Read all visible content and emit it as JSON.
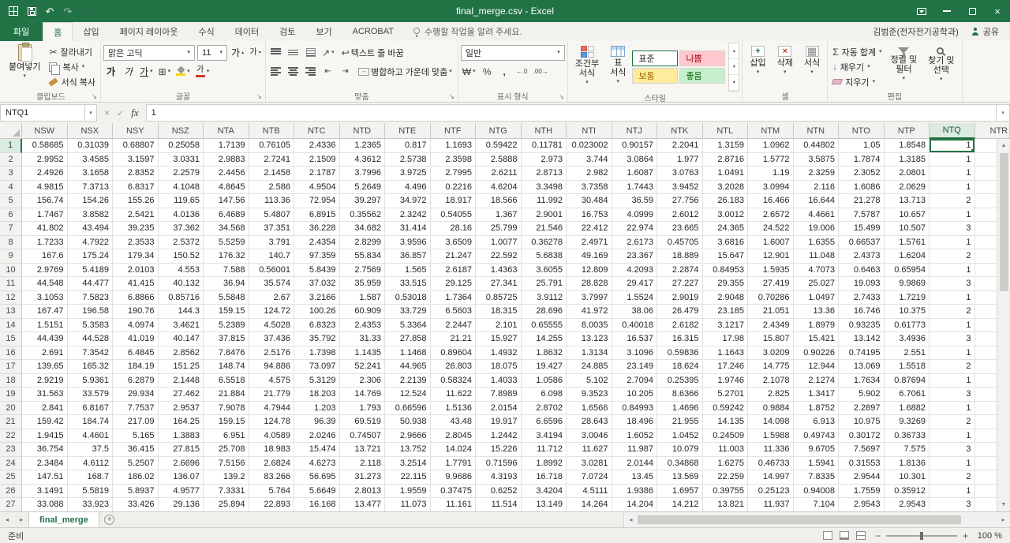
{
  "window": {
    "title": "final_merge.csv - Excel",
    "user": "김범준(전자전기공학과)",
    "share_label": "공유"
  },
  "tabs": {
    "file": "파일",
    "items": [
      "홈",
      "삽입",
      "페이지 레이아웃",
      "수식",
      "데이터",
      "검토",
      "보기",
      "ACROBAT"
    ],
    "tell_me": "수행할 작업을 알려 주세요."
  },
  "ribbon": {
    "clipboard": {
      "label": "클립보드",
      "paste": "붙여넣기",
      "cut": "잘라내기",
      "copy": "복사",
      "format_painter": "서식 복사"
    },
    "font": {
      "label": "글꼴",
      "name": "맑은 고딕",
      "size": "11"
    },
    "alignment": {
      "label": "맞춤",
      "wrap_text": "텍스트 줄 바꿈",
      "merge_center": "병합하고 가운데 맞춤"
    },
    "number": {
      "label": "표시 형식",
      "format_value": "일반"
    },
    "styles": {
      "label": "스타일",
      "conditional": "조건부\n서식",
      "format_table": "표\n서식",
      "gallery": [
        {
          "name": "표준",
          "css": "background:#ffffff;color:#262626"
        },
        {
          "name": "나쁨",
          "css": "background:#ffc7ce;color:#9c0006"
        },
        {
          "name": "보통",
          "css": "background:#ffeb9c;color:#9c6500"
        },
        {
          "name": "좋음",
          "css": "background:#c6efce;color:#006100"
        }
      ]
    },
    "cells": {
      "label": "셀",
      "insert": "삽입",
      "delete": "삭제",
      "format": "서식"
    },
    "editing": {
      "label": "편집",
      "autosum": "자동 합계",
      "fill": "채우기",
      "clear": "지우기",
      "sort_filter": "정렬 및\n필터",
      "find_select": "찾기 및\n선택"
    }
  },
  "formula_bar": {
    "name_box": "NTQ1",
    "fx": "fx",
    "value": "1"
  },
  "sheet": {
    "columns": [
      "NSW",
      "NSX",
      "NSY",
      "NSZ",
      "NTA",
      "NTB",
      "NTC",
      "NTD",
      "NTE",
      "NTF",
      "NTG",
      "NTH",
      "NTI",
      "NTJ",
      "NTK",
      "NTL",
      "NTM",
      "NTN",
      "NTO",
      "NTP",
      "NTQ"
    ],
    "partial_column": "NTR",
    "selected": {
      "col": "NTQ",
      "row": 1
    },
    "rows": [
      [
        "0.58685",
        "0.31039",
        "0.68807",
        "0.25058",
        "1.7139",
        "0.76105",
        "2.4336",
        "1.2365",
        "0.817",
        "1.1693",
        "0.59422",
        "0.11781",
        "0.023002",
        "0.90157",
        "2.2041",
        "1.3159",
        "1.0962",
        "0.44802",
        "1.05",
        "1.8548",
        "1"
      ],
      [
        "2.9952",
        "3.4585",
        "3.1597",
        "3.0331",
        "2.9883",
        "2.7241",
        "2.1509",
        "4.3612",
        "2.5738",
        "2.3598",
        "2.5888",
        "2.973",
        "3.744",
        "3.0864",
        "1.977",
        "2.8716",
        "1.5772",
        "3.5875",
        "1.7874",
        "1.3185",
        "1"
      ],
      [
        "2.4926",
        "3.1658",
        "2.8352",
        "2.2579",
        "2.4456",
        "2.1458",
        "2.1787",
        "3.7996",
        "3.9725",
        "2.7995",
        "2.6211",
        "2.8713",
        "2.982",
        "1.6087",
        "3.0763",
        "1.0491",
        "1.19",
        "2.3259",
        "2.3052",
        "2.0801",
        "1"
      ],
      [
        "4.9815",
        "7.3713",
        "6.8317",
        "4.1048",
        "4.8645",
        "2.586",
        "4.9504",
        "5.2649",
        "4.496",
        "0.2216",
        "4.6204",
        "3.3498",
        "3.7358",
        "1.7443",
        "3.9452",
        "3.2028",
        "3.0994",
        "2.116",
        "1.6086",
        "2.0629",
        "1"
      ],
      [
        "156.74",
        "154.26",
        "155.26",
        "119.65",
        "147.56",
        "113.36",
        "72.954",
        "39.297",
        "34.972",
        "18.917",
        "18.566",
        "11.992",
        "30.484",
        "36.59",
        "27.756",
        "26.183",
        "16.466",
        "16.644",
        "21.278",
        "13.713",
        "2"
      ],
      [
        "1.7467",
        "3.8582",
        "2.5421",
        "4.0136",
        "6.4689",
        "5.4807",
        "6.8915",
        "0.35562",
        "2.3242",
        "0.54055",
        "1.367",
        "2.9001",
        "16.753",
        "4.0999",
        "2.6012",
        "3.0012",
        "2.6572",
        "4.4661",
        "7.5787",
        "10.657",
        "1"
      ],
      [
        "41.802",
        "43.494",
        "39.235",
        "37.362",
        "34.568",
        "37.351",
        "36.228",
        "34.682",
        "31.414",
        "28.16",
        "25.799",
        "21.546",
        "22.412",
        "22.974",
        "23.665",
        "24.365",
        "24.522",
        "19.006",
        "15.499",
        "10.507",
        "3"
      ],
      [
        "1.7233",
        "4.7922",
        "2.3533",
        "2.5372",
        "5.5259",
        "3.791",
        "2.4354",
        "2.8299",
        "3.9596",
        "3.6509",
        "1.0077",
        "0.36278",
        "2.4971",
        "2.6173",
        "0.45705",
        "3.6816",
        "1.6007",
        "1.6355",
        "0.66537",
        "1.5761",
        "1"
      ],
      [
        "167.6",
        "175.24",
        "179.34",
        "150.52",
        "176.32",
        "140.7",
        "97.359",
        "55.834",
        "36.857",
        "21.247",
        "22.592",
        "5.6838",
        "49.169",
        "23.367",
        "18.889",
        "15.647",
        "12.901",
        "11.048",
        "2.4373",
        "1.6204",
        "2"
      ],
      [
        "2.9769",
        "5.4189",
        "2.0103",
        "4.553",
        "7.588",
        "0.56001",
        "5.8439",
        "2.7569",
        "1.565",
        "2.6187",
        "1.4363",
        "3.6055",
        "12.809",
        "4.2093",
        "2.2874",
        "0.84953",
        "1.5935",
        "4.7073",
        "0.6463",
        "0.65954",
        "1"
      ],
      [
        "44.548",
        "44.477",
        "41.415",
        "40.132",
        "36.94",
        "35.574",
        "37.032",
        "35.959",
        "33.515",
        "29.125",
        "27.341",
        "25.791",
        "28.828",
        "29.417",
        "27.227",
        "29.355",
        "27.419",
        "25.027",
        "19.093",
        "9.9869",
        "3"
      ],
      [
        "3.1053",
        "7.5823",
        "6.8866",
        "0.85716",
        "5.5848",
        "2.67",
        "3.2166",
        "1.587",
        "0.53018",
        "1.7364",
        "0.85725",
        "3.9112",
        "3.7997",
        "1.5524",
        "2.9019",
        "2.9048",
        "0.70286",
        "1.0497",
        "2.7433",
        "1.7219",
        "1"
      ],
      [
        "167.47",
        "196.58",
        "190.76",
        "144.3",
        "159.15",
        "124.72",
        "100.26",
        "60.909",
        "33.729",
        "6.5603",
        "18.315",
        "28.696",
        "41.972",
        "38.06",
        "26.479",
        "23.185",
        "21.051",
        "13.36",
        "16.746",
        "10.375",
        "2"
      ],
      [
        "1.5151",
        "5.3583",
        "4.0974",
        "3.4621",
        "5.2389",
        "4.5028",
        "6.8323",
        "2.4353",
        "5.3364",
        "2.2447",
        "2.101",
        "0.65555",
        "8.0035",
        "0.40018",
        "2.6182",
        "3.1217",
        "2.4349",
        "1.8979",
        "0.93235",
        "0.61773",
        "1"
      ],
      [
        "44.439",
        "44.528",
        "41.019",
        "40.147",
        "37.815",
        "37.436",
        "35.792",
        "31.33",
        "27.858",
        "21.21",
        "15.927",
        "14.255",
        "13.123",
        "16.537",
        "16.315",
        "17.98",
        "15.807",
        "15.421",
        "13.142",
        "3.4936",
        "3"
      ],
      [
        "2.691",
        "7.3542",
        "6.4845",
        "2.8562",
        "7.8476",
        "2.5176",
        "1.7398",
        "1.1435",
        "1.1468",
        "0.89604",
        "1.4932",
        "1.8632",
        "1.3134",
        "3.1096",
        "0.59836",
        "1.1643",
        "3.0209",
        "0.90226",
        "0.74195",
        "2.551",
        "1"
      ],
      [
        "139.65",
        "165.32",
        "184.19",
        "151.25",
        "148.74",
        "94.886",
        "73.097",
        "52.241",
        "44.965",
        "26.803",
        "18.075",
        "19.427",
        "24.885",
        "23.149",
        "18.624",
        "17.246",
        "14.775",
        "12.944",
        "13.069",
        "1.5518",
        "2"
      ],
      [
        "2.9219",
        "5.9361",
        "6.2879",
        "2.1448",
        "6.5518",
        "4.575",
        "5.3129",
        "2.306",
        "2.2139",
        "0.58324",
        "1.4033",
        "1.0586",
        "5.102",
        "2.7094",
        "0.25395",
        "1.9746",
        "2.1078",
        "2.1274",
        "1.7634",
        "0.87694",
        "1"
      ],
      [
        "31.563",
        "33.579",
        "29.934",
        "27.462",
        "21.884",
        "21.779",
        "18.203",
        "14.769",
        "12.524",
        "11.622",
        "7.8989",
        "6.098",
        "9.3523",
        "10.205",
        "8.6366",
        "5.2701",
        "2.825",
        "1.3417",
        "5.902",
        "6.7061",
        "3"
      ],
      [
        "2.841",
        "6.8167",
        "7.7537",
        "2.9537",
        "7.9078",
        "4.7944",
        "1.203",
        "1.793",
        "0.66596",
        "1.5136",
        "2.0154",
        "2.8702",
        "1.6566",
        "0.84993",
        "1.4696",
        "0.59242",
        "0.9884",
        "1.8752",
        "2.2897",
        "1.6882",
        "1"
      ],
      [
        "159.42",
        "184.74",
        "217.09",
        "164.25",
        "159.15",
        "124.78",
        "96.39",
        "69.519",
        "50.938",
        "43.48",
        "19.917",
        "6.6596",
        "28.643",
        "18.496",
        "21.955",
        "14.135",
        "14.098",
        "6.913",
        "10.975",
        "9.3269",
        "2"
      ],
      [
        "1.9415",
        "4.4601",
        "5.165",
        "1.3883",
        "6.951",
        "4.0589",
        "2.0246",
        "0.74507",
        "2.9666",
        "2.8045",
        "1.2442",
        "3.4194",
        "3.0046",
        "1.6052",
        "1.0452",
        "0.24509",
        "1.5988",
        "0.49743",
        "0.30172",
        "0.36733",
        "1"
      ],
      [
        "36.754",
        "37.5",
        "36.415",
        "27.815",
        "25.708",
        "18.983",
        "15.474",
        "13.721",
        "13.752",
        "14.024",
        "15.226",
        "11.712",
        "11.627",
        "11.987",
        "10.079",
        "11.003",
        "11.336",
        "9.6705",
        "7.5697",
        "7.575",
        "3"
      ],
      [
        "2.3484",
        "4.6112",
        "5.2507",
        "2.6696",
        "7.5156",
        "2.6824",
        "4.6273",
        "2.118",
        "3.2514",
        "1.7791",
        "0.71596",
        "1.8992",
        "3.0281",
        "2.0144",
        "0.34868",
        "1.6275",
        "0.46733",
        "1.5941",
        "0.31553",
        "1.8136",
        "1"
      ],
      [
        "147.51",
        "168.7",
        "186.02",
        "136.07",
        "139.2",
        "83.266",
        "56.695",
        "31.273",
        "22.115",
        "9.9686",
        "4.3193",
        "16.718",
        "7.0724",
        "13.45",
        "13.569",
        "22.259",
        "14.997",
        "7.8335",
        "2.9544",
        "10.301",
        "2"
      ],
      [
        "3.1491",
        "5.5819",
        "5.8937",
        "4.9577",
        "7.3331",
        "5.764",
        "5.6649",
        "2.8013",
        "1.9559",
        "0.37475",
        "0.6252",
        "3.4204",
        "4.5111",
        "1.9386",
        "1.6957",
        "0.39755",
        "0.25123",
        "0.94008",
        "1.7559",
        "0.35912",
        "1"
      ],
      [
        "33.088",
        "33.923",
        "33.426",
        "29.136",
        "25.894",
        "22.893",
        "16.168",
        "13.477",
        "11.073",
        "11.161",
        "11.514",
        "13.149",
        "14.264",
        "14.204",
        "14.212",
        "13.821",
        "11.937",
        "7.104",
        "2.9543",
        "2.9543",
        "3"
      ]
    ]
  },
  "sheet_tabs": {
    "active": "final_merge"
  },
  "status": {
    "ready": "준비",
    "zoom": "100 %"
  }
}
